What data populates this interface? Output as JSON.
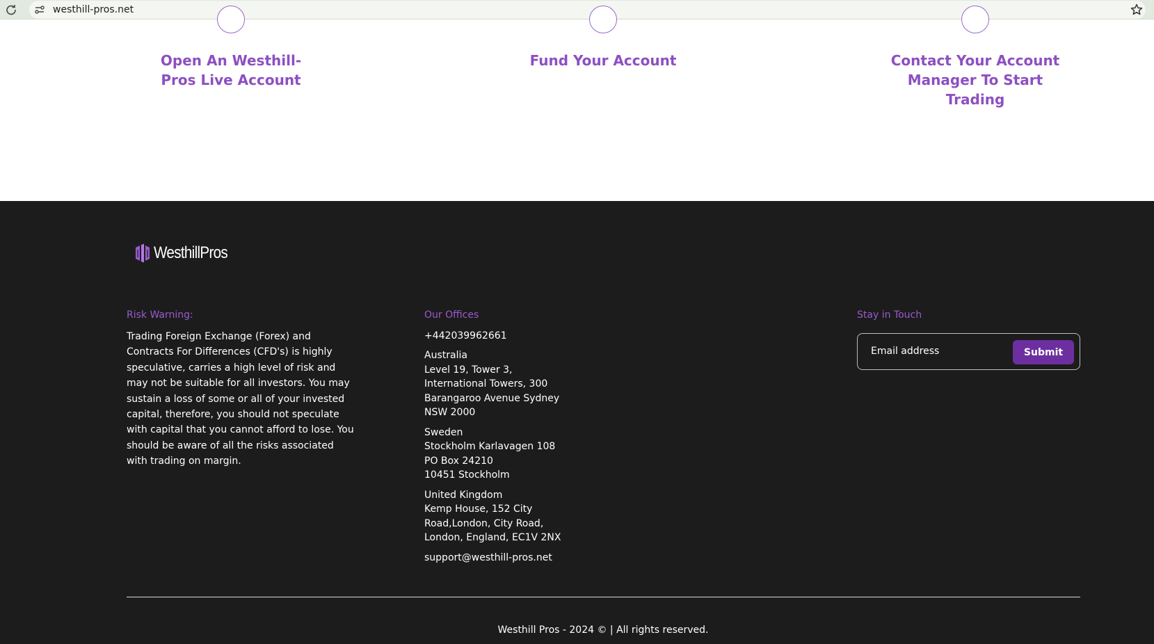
{
  "browser": {
    "url": "westhill-pros.net"
  },
  "steps": [
    {
      "title": "Open An Westhill-Pros Live Account"
    },
    {
      "title": "Fund Your Account"
    },
    {
      "title": "Contact Your Account Manager To Start Trading"
    }
  ],
  "footer": {
    "logo_text": "WesthillPros",
    "risk": {
      "heading": "Risk Warning:",
      "text": "Trading Foreign Exchange (Forex) and Contracts For Differences (CFD's) is highly speculative, carries a high level of risk and may not be suitable for all investors. You may sustain a loss of some or all of your invested capital, therefore, you should not speculate with capital that you cannot afford to lose. You should be aware of all the risks associated with trading on margin."
    },
    "offices": {
      "heading": "Our Offices",
      "phone": "+442039962661",
      "locations": [
        {
          "lines": [
            "Australia",
            "Level 19, Tower 3,",
            "International Towers, 300",
            "Barangaroo Avenue Sydney",
            "NSW 2000"
          ]
        },
        {
          "lines": [
            "Sweden",
            "Stockholm Karlavagen 108",
            "PO Box 24210",
            "10451 Stockholm"
          ]
        },
        {
          "lines": [
            "United Kingdom",
            "Kemp House, 152 City",
            "Road,London, City Road,",
            "London, England, EC1V 2NX"
          ]
        }
      ],
      "email": "support@westhill-pros.net"
    },
    "newsletter": {
      "heading": "Stay in Touch",
      "placeholder": "Email address",
      "submit_label": "Submit"
    },
    "copyright": "Westhill Pros - 2024 © | All rights reserved."
  },
  "colors": {
    "accent": "#8d4fc2",
    "button": "#6d2fa0",
    "footer_bg": "#1c1c1c"
  }
}
